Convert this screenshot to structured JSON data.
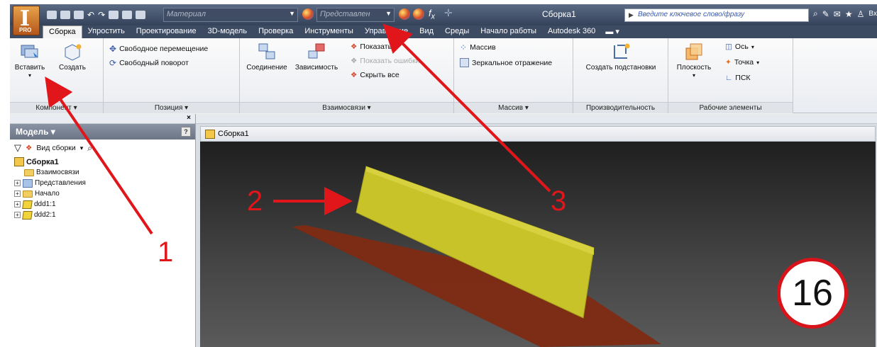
{
  "title_bar": {
    "app_logo_letter": "I",
    "app_logo_edition": "PRO",
    "material_combo": "Материал",
    "representation_combo": "Представлен",
    "document_title": "Сборка1",
    "search_placeholder": "Введите ключевое слово/фразу",
    "sign_in": "Вход"
  },
  "tabs": [
    "Сборка",
    "Упростить",
    "Проектирование",
    "3D-модель",
    "Проверка",
    "Инструменты",
    "Управление",
    "Вид",
    "Среды",
    "Начало работы",
    "Autodesk 360"
  ],
  "ribbon": {
    "component_panel": {
      "title": "Компонент ▾",
      "insert": "Вставить",
      "create": "Создать"
    },
    "position_panel": {
      "title": "Позиция ▾",
      "free_move": "Свободное перемещение",
      "free_rotate": "Свободный поворот"
    },
    "relationships_panel": {
      "title": "Взаимосвязи ▾",
      "joint": "Соединение",
      "constraint": "Зависимость",
      "show": "Показать",
      "show_errors": "Показать ошибки",
      "hide_all": "Скрыть все"
    },
    "pattern_panel": {
      "title": "Массив ▾",
      "pattern": "Массив",
      "mirror": "Зеркальное отражение"
    },
    "productivity_panel": {
      "title": "Производительность",
      "create_substitute": "Создать подстановки"
    },
    "work_features_panel": {
      "title": "Рабочие элементы",
      "plane": "Плоскость",
      "axis": "Ось",
      "point": "Точка",
      "ucs": "ПСК"
    }
  },
  "browser": {
    "header": "Модель ▾",
    "help": "?",
    "view_mode": "Вид сборки",
    "tree": [
      {
        "label": "Сборка1",
        "type": "assembly",
        "level": 0
      },
      {
        "label": "Взаимосвязи",
        "type": "folder",
        "level": 1
      },
      {
        "label": "Представления",
        "type": "representations",
        "level": 1
      },
      {
        "label": "Начало",
        "type": "folder",
        "level": 1
      },
      {
        "label": "ddd1:1",
        "type": "part",
        "level": 1
      },
      {
        "label": "ddd2:1",
        "type": "part",
        "level": 1
      }
    ]
  },
  "graphics": {
    "document_tab": "Сборка1"
  },
  "annotations": {
    "label1": "1",
    "label2": "2",
    "label3": "3",
    "slide_number": "16"
  },
  "colors": {
    "annotation_red": "#e0161b",
    "part_yellow": "#c9c32a",
    "part_red": "#8e2b10",
    "title_bar": "#3c4a62"
  }
}
